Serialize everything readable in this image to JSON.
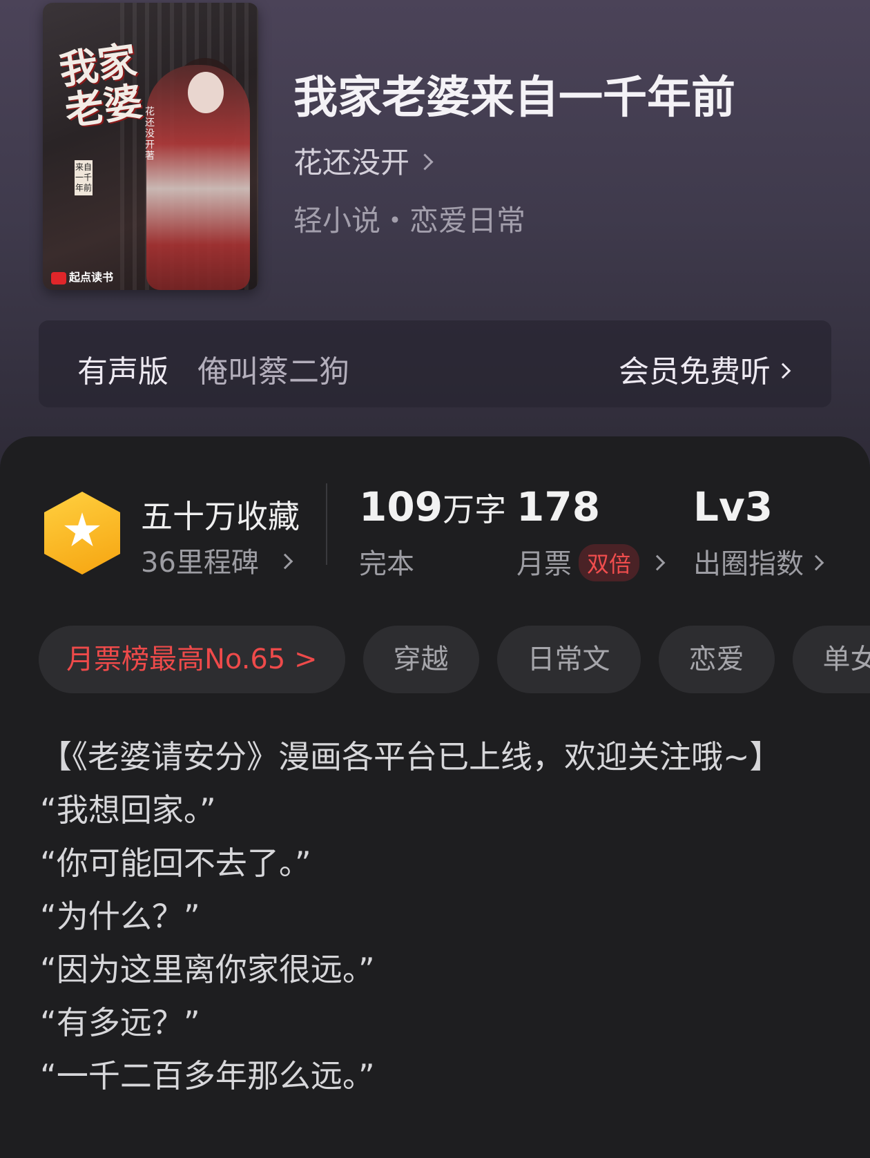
{
  "book": {
    "title": "我家老婆来自一千年前",
    "author": "花还没开",
    "genre": "轻小说・恋爱日常",
    "cover": {
      "title_art": "我家老婆",
      "subtitle_art": "来自一千年前",
      "author_art": "花还没开著",
      "publisher_logo": "起点读书"
    }
  },
  "audio": {
    "label": "有声版",
    "narrator": "俺叫蔡二狗",
    "action": "会员免费听"
  },
  "stats": {
    "collect_title": "五十万收藏",
    "collect_sub": "36里程碑",
    "words_num": "109",
    "words_unit": "万字",
    "status": "完本",
    "tickets_num": "178",
    "tickets_label": "月票",
    "tickets_badge": "双倍",
    "level": "Lv3",
    "level_label": "出圈指数"
  },
  "tags": [
    "月票榜最高No.65 >",
    "穿越",
    "日常文",
    "恋爱",
    "单女主"
  ],
  "description": [
    "【《老婆请安分》漫画各平台已上线，欢迎关注哦~】",
    "“我想回家。”",
    "“你可能回不去了。”",
    "“为什么？”",
    "“因为这里离你家很远。”",
    "“有多远？”",
    "“一千二百多年那么远。”"
  ],
  "colors": {
    "accent_red": "#ee4a4a",
    "gold": "#f6a410",
    "panel": "#1e1e20"
  }
}
